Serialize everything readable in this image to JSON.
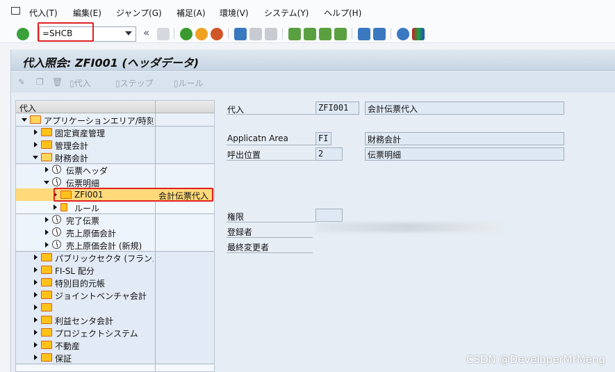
{
  "menubar": {
    "items": [
      "代入(T)",
      "編集(E)",
      "ジャンプ(G)",
      "補足(A)",
      "環境(V)",
      "システム(Y)",
      "ヘルプ(H)"
    ]
  },
  "toolbar": {
    "command_value": "=SHCB"
  },
  "title": "代入照会: ZFI001 (ヘッダデータ)",
  "app_toolbar": {
    "items": [
      "代入",
      "ステップ",
      "ルール"
    ]
  },
  "tree": {
    "headers": [
      "代入",
      ""
    ],
    "rows": [
      {
        "label": "アプリケーションエリア/時刻",
        "level": 0,
        "icon": "folder-open",
        "open": true
      },
      {
        "label": "固定資産管理",
        "level": 1,
        "icon": "folder",
        "open": false
      },
      {
        "label": "管理会計",
        "level": 1,
        "icon": "folder",
        "open": false
      },
      {
        "label": "財務会計",
        "level": 1,
        "icon": "folder-open",
        "open": true
      },
      {
        "label": "伝票ヘッダ",
        "level": 2,
        "icon": "clock",
        "open": false
      },
      {
        "label": "伝票明細",
        "level": 2,
        "icon": "clock",
        "open": true
      },
      {
        "label": "ZFI001",
        "level": 3,
        "icon": "folder",
        "open": false,
        "desc": "会計伝票代入",
        "selected": true
      },
      {
        "label": "ルール",
        "level": 3,
        "icon": "rule",
        "open": false
      },
      {
        "label": "完了伝票",
        "level": 2,
        "icon": "clock",
        "open": false
      },
      {
        "label": "売上原価会計",
        "level": 2,
        "icon": "clock",
        "open": false
      },
      {
        "label": "売上原価会計 (新規)",
        "level": 2,
        "icon": "clock",
        "open": false
      },
      {
        "label": "パブリックセクタ (フランス)",
        "level": 1,
        "icon": "folder",
        "open": false
      },
      {
        "label": "FI-SL 配分",
        "level": 1,
        "icon": "folder",
        "open": false
      },
      {
        "label": "特別目的元帳",
        "level": 1,
        "icon": "folder",
        "open": false
      },
      {
        "label": "ジョイントベンチャ会計",
        "level": 1,
        "icon": "folder",
        "open": false
      },
      {
        "label": "",
        "level": 1,
        "icon": "folder",
        "open": false
      },
      {
        "label": "利益センタ会計",
        "level": 1,
        "icon": "folder",
        "open": false
      },
      {
        "label": "プロジェクトシステム",
        "level": 1,
        "icon": "folder",
        "open": false
      },
      {
        "label": "不動産",
        "level": 1,
        "icon": "folder",
        "open": false
      },
      {
        "label": "保証",
        "level": 1,
        "icon": "folder",
        "open": false
      }
    ]
  },
  "detail": {
    "substitution_label": "代入",
    "substitution_value": "ZFI001",
    "substitution_desc": "会計伝票代入",
    "area_label": "Applicatn Area",
    "area_value": "FI",
    "area_desc": "財務会計",
    "callup_label": "呼出位置",
    "callup_value": "2",
    "callup_desc": "伝票明細",
    "auth_label": "権限",
    "auth_value": "",
    "created_label": "登録者",
    "changed_label": "最終変更者"
  },
  "watermark": "CSDN @DeveloperMrMeng"
}
